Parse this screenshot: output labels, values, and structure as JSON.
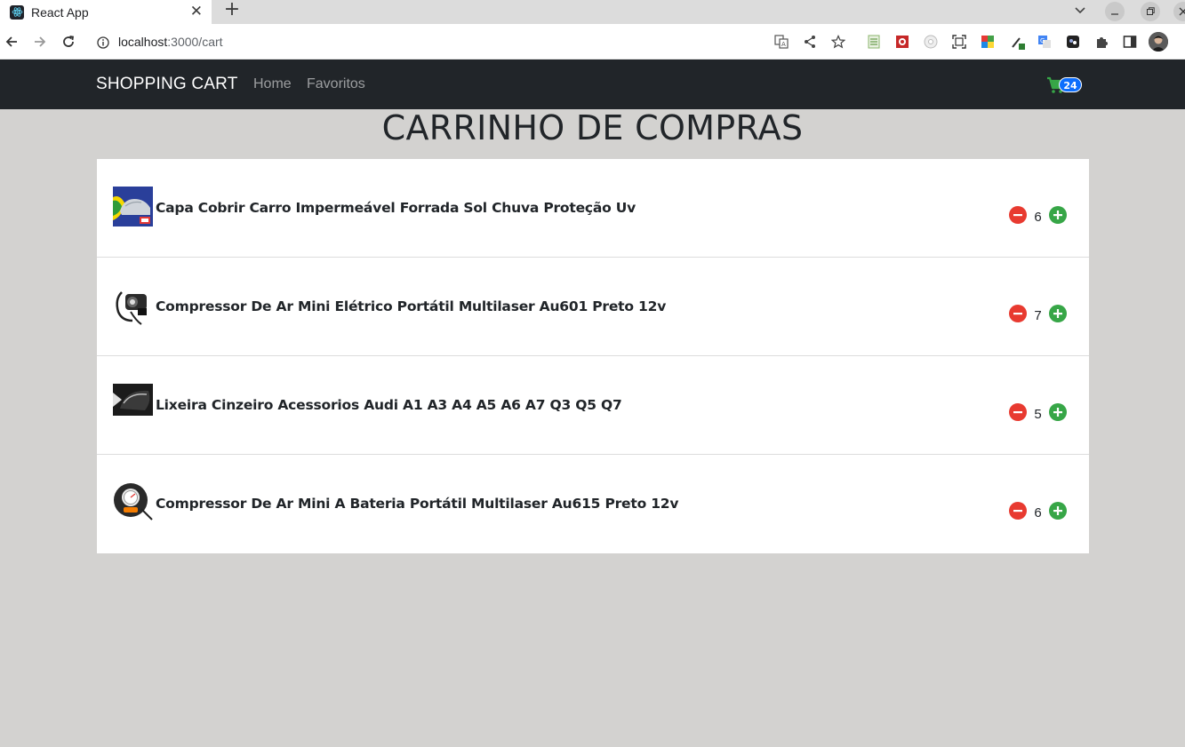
{
  "browser": {
    "tab_title": "React App",
    "tab_close": "✕",
    "new_tab": "+",
    "url_host": "localhost",
    "url_path": ":3000/cart"
  },
  "navbar": {
    "brand": "SHOPPING CART",
    "links": [
      "Home",
      "Favoritos"
    ],
    "cart_count": "24"
  },
  "page": {
    "title": "CARRINHO DE COMPRAS"
  },
  "cart": {
    "items": [
      {
        "name": "Capa Cobrir Carro Impermeável Forrada Sol Chuva Proteção Uv",
        "quantity": "6",
        "image": "car-cover-image"
      },
      {
        "name": "Compressor De Ar Mini Elétrico Portátil Multilaser Au601 Preto 12v",
        "quantity": "7",
        "image": "air-compressor-image"
      },
      {
        "name": "Lixeira Cinzeiro Acessorios Audi A1 A3 A4 A5 A6 A7 Q3 Q5 Q7",
        "quantity": "5",
        "image": "trash-bin-image"
      },
      {
        "name": "Compressor De Ar Mini A Bateria Portátil Multilaser Au615 Preto 12v",
        "quantity": "6",
        "image": "battery-compressor-image"
      }
    ]
  },
  "colors": {
    "navbar_bg": "#212529",
    "page_bg": "#d3d2d0",
    "minus_button": "#e83a30",
    "plus_button": "#37a647",
    "cart_icon": "#37a647",
    "badge": "#0d6efd"
  }
}
